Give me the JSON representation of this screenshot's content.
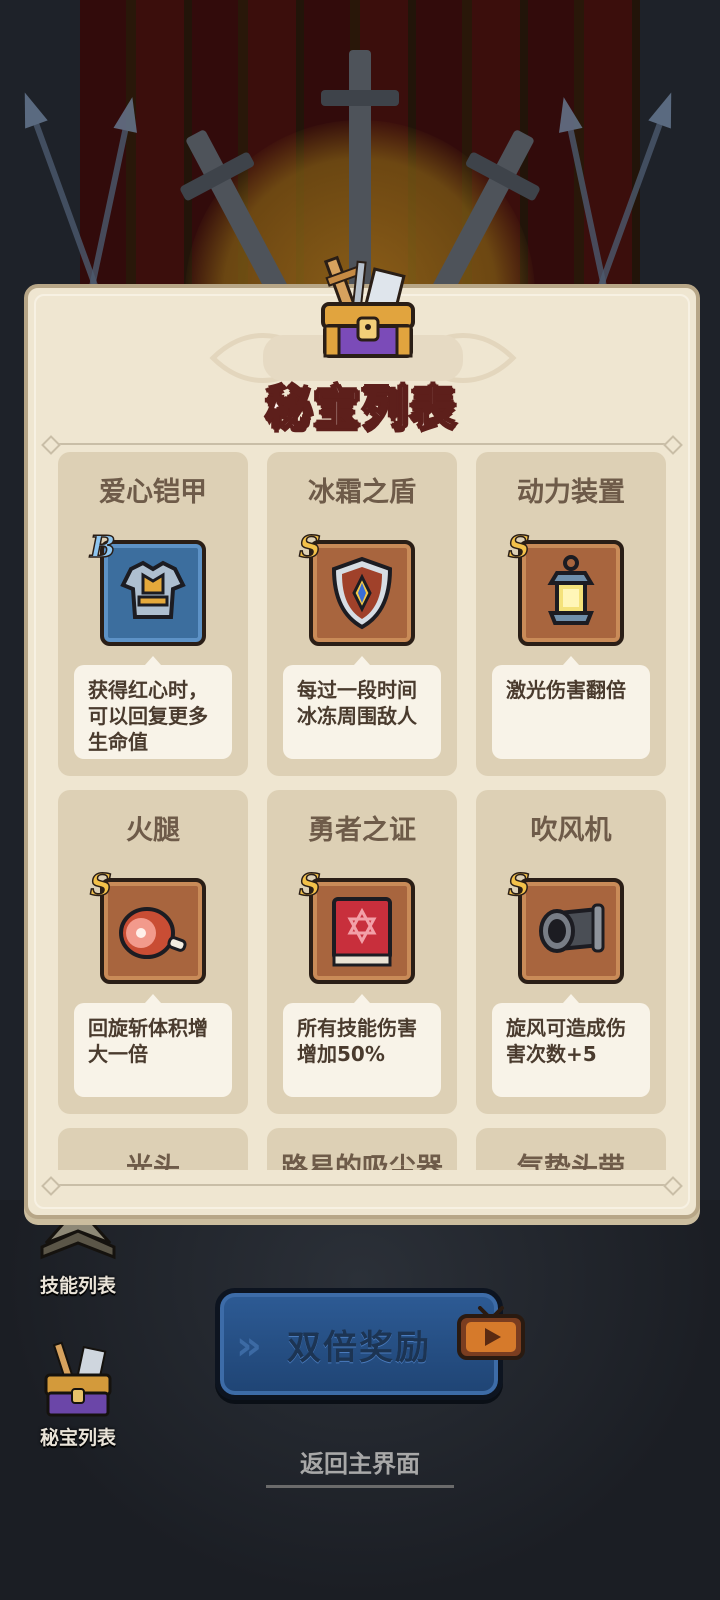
{
  "panel": {
    "title": "秘宝列表",
    "icon": "treasure-chest-icon"
  },
  "treasures": [
    {
      "name": "爱心铠甲",
      "rank": "B",
      "icon": "armor-icon",
      "desc": "获得红心时，可以回复更多生命值"
    },
    {
      "name": "冰霜之盾",
      "rank": "S",
      "icon": "shield-icon",
      "desc": "每过一段时间冰冻周围敌人"
    },
    {
      "name": "动力装置",
      "rank": "S",
      "icon": "lantern-icon",
      "desc": "激光伤害翻倍"
    },
    {
      "name": "火腿",
      "rank": "S",
      "icon": "ham-icon",
      "desc": "回旋斩体积增大一倍"
    },
    {
      "name": "勇者之证",
      "rank": "S",
      "icon": "book-icon",
      "desc": "所有技能伤害增加50%"
    },
    {
      "name": "吹风机",
      "rank": "S",
      "icon": "cannon-icon",
      "desc": "旋风可造成伤害次数+5"
    },
    {
      "name": "光头",
      "rank": "",
      "icon": "",
      "desc": ""
    },
    {
      "name": "路易的吸尘器",
      "rank": "",
      "icon": "",
      "desc": ""
    },
    {
      "name": "气势头带",
      "rank": "",
      "icon": "",
      "desc": ""
    }
  ],
  "side_buttons": {
    "skills_label": "技能列表",
    "treasures_label": "秘宝列表"
  },
  "reward_button": {
    "label": "双倍奖励",
    "icon": "tv-play-icon"
  },
  "return_link": "返回主界面",
  "colors": {
    "panel_bg": "#efe6d1",
    "card_bg": "#ddd0b5",
    "title_outline": "#5d1f1b",
    "rank_S": "#f3c14a",
    "rank_B": "#8fc6f0",
    "reward_button": "#2d5b95"
  }
}
